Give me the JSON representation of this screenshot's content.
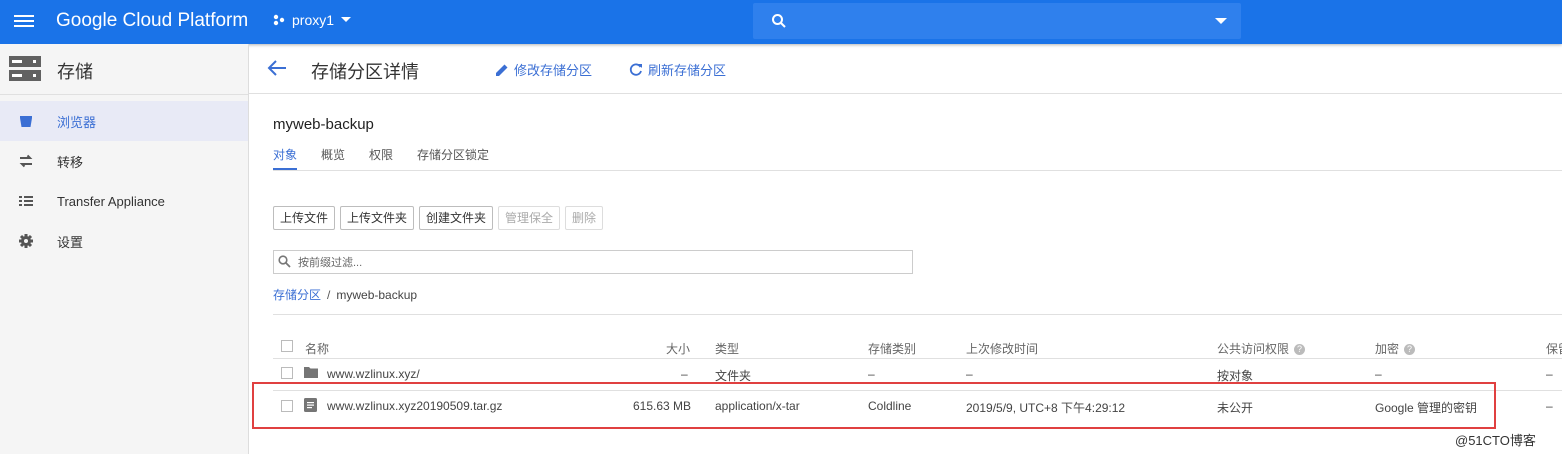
{
  "topbar": {
    "brand": "Google Cloud Platform",
    "project": "proxy1",
    "icons": [
      "menu-icon",
      "project-dots-icon",
      "chevron-down-icon",
      "search-icon"
    ],
    "accent": "#1a73e8"
  },
  "sidebar": {
    "title": "存储",
    "items": [
      {
        "label": "浏览器",
        "icon": "bucket-icon",
        "active": true
      },
      {
        "label": "转移",
        "icon": "transfer-arrows-icon"
      },
      {
        "label": "Transfer Appliance",
        "icon": "appliance-list-icon"
      },
      {
        "label": "设置",
        "icon": "gear-icon"
      }
    ]
  },
  "header": {
    "title": "存储分区详情",
    "edit_label": "修改存储分区",
    "refresh_label": "刷新存储分区"
  },
  "bucket": {
    "name": "myweb-backup",
    "tabs": [
      "对象",
      "概览",
      "权限",
      "存储分区锁定"
    ],
    "active_tab": "对象"
  },
  "toolbar": {
    "upload_files": "上传文件",
    "upload_folder": "上传文件夹",
    "create_folder": "创建文件夹",
    "manage_holds": "管理保全",
    "delete": "删除"
  },
  "filter": {
    "placeholder": "按前缀过滤..."
  },
  "breadcrumb": {
    "root": "存储分区",
    "separator": "/",
    "current": "myweb-backup"
  },
  "table": {
    "headers": {
      "name": "名称",
      "size": "大小",
      "type": "类型",
      "storage_class": "存储类别",
      "modified": "上次修改时间",
      "public_access": "公共访问权限",
      "encryption": "加密",
      "retention": "保留"
    },
    "rows": [
      {
        "icon": "folder-icon",
        "name": "www.wzlinux.xyz/",
        "size": "–",
        "type": "文件夹",
        "storage_class": "–",
        "modified": "–",
        "public_access": "按对象",
        "encryption": "–",
        "retention": "–"
      },
      {
        "icon": "file-icon",
        "name": "www.wzlinux.xyz20190509.tar.gz",
        "size": "615.63 MB",
        "type": "application/x-tar",
        "storage_class": "Coldline",
        "modified": "2019/5/9, UTC+8 下午4:29:12",
        "public_access": "未公开",
        "encryption": "Google 管理的密钥",
        "retention": "–"
      }
    ]
  },
  "watermark": "@51CTO博客",
  "highlight_color": "#e04040"
}
